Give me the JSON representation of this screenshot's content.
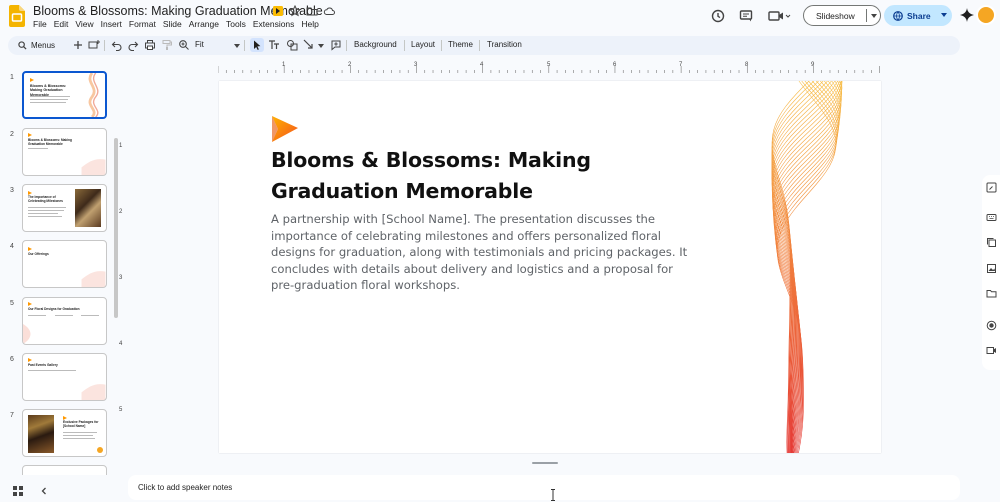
{
  "doc": {
    "title": "Blooms & Blossoms: Making Graduation Memorable"
  },
  "menu": [
    "File",
    "Edit",
    "View",
    "Insert",
    "Format",
    "Slide",
    "Arrange",
    "Tools",
    "Extensions",
    "Help"
  ],
  "header": {
    "slideshow_label": "Slideshow",
    "share_label": "Share"
  },
  "toolbar": {
    "search_label": "Menus",
    "zoom_label": "Fit",
    "background_label": "Background",
    "layout_label": "Layout",
    "theme_label": "Theme",
    "transition_label": "Transition"
  },
  "filmstrip": {
    "slides": [
      {
        "num": "1",
        "title": "Blooms & Blossoms: Making Graduation Memorable"
      },
      {
        "num": "2",
        "title": "Blooms & Blossoms: Making Graduation Memorable"
      },
      {
        "num": "3",
        "title": "The Importance of Celebrating Milestones"
      },
      {
        "num": "4",
        "title": "Our Offerings"
      },
      {
        "num": "5",
        "title": "Our Floral Designs for Graduation"
      },
      {
        "num": "6",
        "title": "Past Events Gallery"
      },
      {
        "num": "7",
        "title": "Exclusive Packages for [School Name]"
      }
    ]
  },
  "rulers": {
    "h": [
      "1",
      "2",
      "3",
      "4",
      "5",
      "6",
      "7",
      "8",
      "9"
    ],
    "v": [
      "1",
      "2",
      "3",
      "4",
      "5"
    ]
  },
  "slide": {
    "title": "Blooms & Blossoms: Making Graduation Memorable",
    "subtitle": "A partnership with [School Name]. The presentation discusses the importance of celebrating milestones and offers personalized floral designs for graduation, along with testimonials and pricing packages. It concludes with details about delivery and logistics and a proposal for pre-graduation floral workshops."
  },
  "notes": {
    "placeholder": "Click to add speaker notes"
  },
  "colors": {
    "accent": "#0b57d0",
    "share_bg": "#c2e7ff",
    "logo_orange": "#ff9800",
    "wave_top": "#f5b642",
    "wave_bottom": "#e53935"
  }
}
